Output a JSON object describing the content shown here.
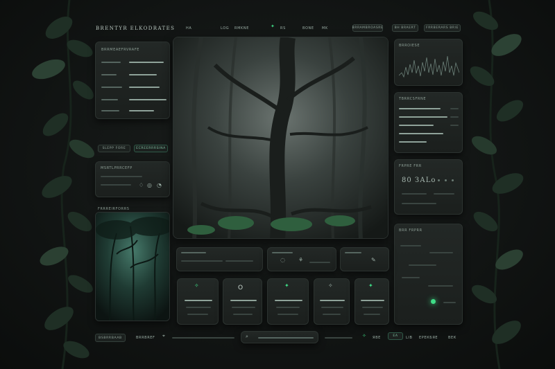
{
  "header": {
    "app_title": "BRENTYR ELKODRATES",
    "toolbar": [
      "HA",
      "LOG",
      "RMKNE",
      "RS",
      "BONE",
      "MK"
    ],
    "chips": [
      "BRRAMBROASRE",
      "BH BRAERT",
      "FRRBERARS BRIE"
    ]
  },
  "left": {
    "controls_panel_title": "BRRMEAEFRVRAFE",
    "buttons": [
      "SLEPP FORE",
      "ECREERRRSINA"
    ],
    "mini_panel_title": "MSRTLPRRCEFP",
    "thumb_title": "FRRREIRFORRS"
  },
  "right": {
    "wave_title": "BRROIESE",
    "sliders_title": "TBRRCSFRNE",
    "readout_title": "FRPRE FRR",
    "readout_value": "80 ЗАLо",
    "map_title": "BRR FRPRR"
  },
  "cards": [
    "",
    "O",
    "",
    "",
    ""
  ],
  "footer": {
    "left_button": "BSBRRBAAB",
    "left_text": "BRRBREF",
    "nav": [
      "ЯВЕ",
      "ЕА",
      "LIB",
      "ЕРЕКБЯЕ",
      "ВЕК"
    ]
  },
  "colors": {
    "accent": "#3fdc86",
    "panel": "#1f2422",
    "background": "#141716"
  }
}
